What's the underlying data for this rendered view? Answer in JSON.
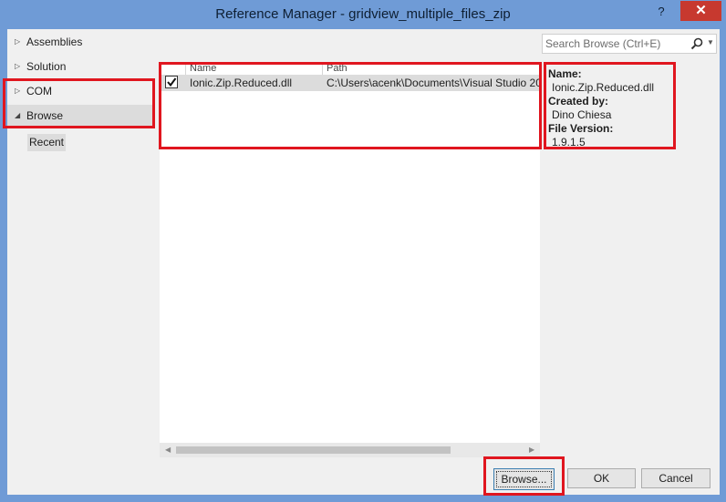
{
  "window": {
    "title": "Reference Manager - gridview_multiple_files_zip",
    "help": "?",
    "close": "✕"
  },
  "sidebar": {
    "items": [
      {
        "label": "Assemblies",
        "arrow": "▷"
      },
      {
        "label": "Solution",
        "arrow": "▷"
      },
      {
        "label": "COM",
        "arrow": "▷"
      },
      {
        "label": "Browse",
        "arrow": "◢"
      }
    ],
    "recent": "Recent"
  },
  "search": {
    "placeholder": "Search Browse (Ctrl+E)",
    "icon": "search-icon"
  },
  "list": {
    "columns": [
      "Name",
      "Path"
    ],
    "rows": [
      {
        "checked": true,
        "name": "Ionic.Zip.Reduced.dll",
        "path": "C:\\Users\\acenk\\Documents\\Visual Studio 20"
      }
    ]
  },
  "details": {
    "name_label": "Name:",
    "name_value": "Ionic.Zip.Reduced.dll",
    "created_label": "Created by:",
    "created_value": "Dino Chiesa",
    "version_label": "File Version:",
    "version_value": "1.9.1.5"
  },
  "buttons": {
    "browse": "Browse...",
    "ok": "OK",
    "cancel": "Cancel"
  },
  "colors": {
    "titlebar": "#6f9bd6",
    "highlight_box": "#e0161f",
    "close": "#c7392f"
  }
}
